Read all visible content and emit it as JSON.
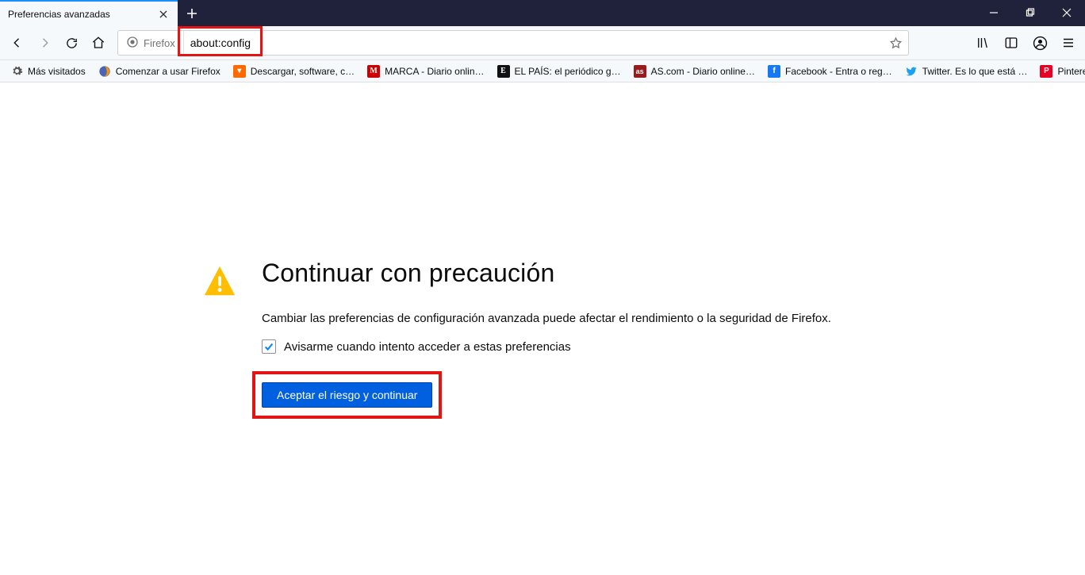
{
  "tab": {
    "title": "Preferencias avanzadas"
  },
  "nav": {
    "identity_label": "Firefox",
    "url": "about:config"
  },
  "bookmarks": [
    {
      "label": "Más visitados",
      "icon": "gear"
    },
    {
      "label": "Comenzar a usar Firefox",
      "icon": "firefox"
    },
    {
      "label": "Descargar, software, c…",
      "icon": "orange"
    },
    {
      "label": "MARCA - Diario onlin…",
      "icon": "marca"
    },
    {
      "label": "EL PAÍS: el periódico g…",
      "icon": "elpais"
    },
    {
      "label": "AS.com - Diario online…",
      "icon": "as"
    },
    {
      "label": "Facebook - Entra o reg…",
      "icon": "facebook"
    },
    {
      "label": "Twitter. Es lo que está …",
      "icon": "twitter"
    },
    {
      "label": "Pinterest",
      "icon": "pinterest"
    }
  ],
  "warning": {
    "title": "Continuar con precaución",
    "description": "Cambiar las preferencias de configuración avanzada puede afectar el rendimiento o la seguridad de Firefox.",
    "checkbox_label": "Avisarme cuando intento acceder a estas preferencias",
    "checkbox_checked": true,
    "accept_label": "Aceptar el riesgo y continuar"
  },
  "highlights": {
    "url_highlighted": true,
    "accept_highlighted": true
  }
}
